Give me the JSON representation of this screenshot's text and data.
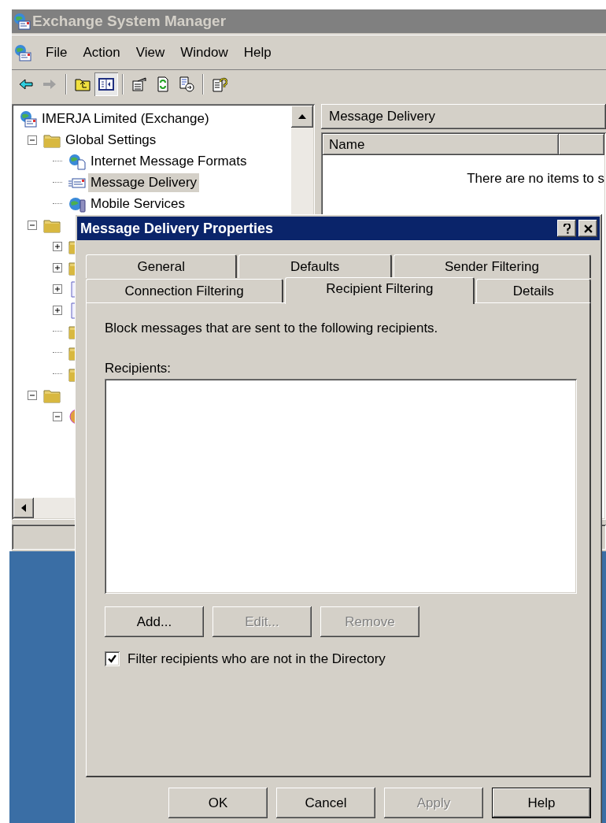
{
  "window": {
    "title": "Exchange System Manager"
  },
  "menu": [
    "File",
    "Action",
    "View",
    "Window",
    "Help"
  ],
  "toolbar": [
    {
      "kind": "back",
      "disabled": false,
      "pressed": false
    },
    {
      "kind": "forward",
      "disabled": true,
      "pressed": false
    },
    {
      "kind": "separator"
    },
    {
      "kind": "up",
      "pressed": false
    },
    {
      "kind": "tree-toggle",
      "pressed": true
    },
    {
      "kind": "separator"
    },
    {
      "kind": "properties",
      "pressed": false
    },
    {
      "kind": "refresh",
      "pressed": false
    },
    {
      "kind": "export",
      "pressed": false
    },
    {
      "kind": "separator"
    },
    {
      "kind": "help",
      "pressed": false
    }
  ],
  "tree": [
    {
      "kind": "server",
      "label": "IMERJA Limited (Exchange)",
      "selected": false,
      "children": [
        {
          "kind": "folder",
          "label": "Global Settings",
          "expanded": true,
          "selected": false,
          "children": [
            {
              "kind": "globe-doc",
              "label": "Internet Message Formats",
              "selected": false
            },
            {
              "kind": "mail",
              "label": "Message Delivery",
              "selected": true
            },
            {
              "kind": "mobile",
              "label": "Mobile Services",
              "selected": false
            }
          ]
        },
        {
          "kind": "folder",
          "expanded": true,
          "children": [
            {
              "kind": "folder",
              "expanded": false
            },
            {
              "kind": "folder",
              "expanded": false
            },
            {
              "kind": "doc",
              "expanded": false
            },
            {
              "kind": "doc",
              "expanded": false
            },
            {
              "kind": "folder"
            },
            {
              "kind": "folder"
            },
            {
              "kind": "folder"
            }
          ]
        },
        {
          "kind": "folder",
          "expanded": true,
          "children": [
            {
              "kind": "org",
              "expanded": true
            }
          ]
        }
      ]
    }
  ],
  "details": {
    "title": "Message Delivery",
    "columns": [
      "Name"
    ],
    "empty_message": "There are no items to s"
  },
  "dialog": {
    "title": "Message Delivery Properties",
    "tab_rows": [
      [
        {
          "label": "General",
          "selected": false
        },
        {
          "label": "Defaults",
          "selected": false
        },
        {
          "label": "Sender Filtering",
          "selected": false
        }
      ],
      [
        {
          "label": "Connection Filtering",
          "selected": false
        },
        {
          "label": "Recipient Filtering",
          "selected": true
        },
        {
          "label": "Details",
          "selected": false
        }
      ]
    ],
    "description": "Block messages that are sent to the following recipients.",
    "list_label": "Recipients:",
    "list_buttons": [
      {
        "label": "Add...",
        "disabled": false
      },
      {
        "label": "Edit...",
        "disabled": true
      },
      {
        "label": "Remove",
        "disabled": true
      }
    ],
    "checkbox": {
      "label": "Filter recipients who are not in the Directory",
      "checked": true
    },
    "buttons": [
      {
        "label": "OK",
        "disabled": false,
        "default": false
      },
      {
        "label": "Cancel",
        "disabled": false,
        "default": false
      },
      {
        "label": "Apply",
        "disabled": true,
        "default": false
      },
      {
        "label": "Help",
        "disabled": false,
        "default": true
      }
    ]
  }
}
